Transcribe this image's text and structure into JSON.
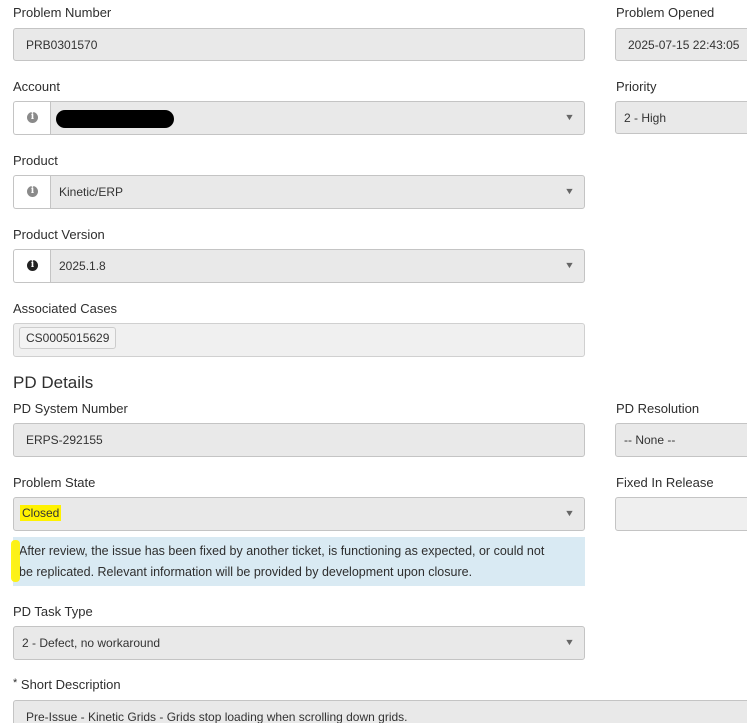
{
  "problem_number": {
    "label": "Problem Number",
    "value": "PRB0301570"
  },
  "problem_opened": {
    "label": "Problem Opened",
    "value": "2025-07-15 22:43:05"
  },
  "account": {
    "label": "Account",
    "value": "",
    "redacted": true,
    "info_icon": "info-icon"
  },
  "priority": {
    "label": "Priority",
    "value": "2 - High"
  },
  "product": {
    "label": "Product",
    "value": "Kinetic/ERP",
    "info_icon": "info-icon"
  },
  "product_version": {
    "label": "Product Version",
    "value": "2025.1.8",
    "info_icon": "info-icon"
  },
  "associated_cases": {
    "label": "Associated Cases",
    "tags": [
      "CS0005015629"
    ]
  },
  "pd_details": {
    "heading": "PD Details"
  },
  "pd_system_number": {
    "label": "PD System Number",
    "value": "ERPS-292155"
  },
  "pd_resolution": {
    "label": "PD Resolution",
    "value": "-- None --"
  },
  "problem_state": {
    "label": "Problem State",
    "value": "Closed",
    "info_line_1": "After review, the issue has been fixed by another ticket, is functioning as expected, or could not",
    "info_line_2": "be replicated. Relevant information will be provided by development upon closure.",
    "highlight_color": "#fff200",
    "info_bg": "#d9eaf3"
  },
  "fixed_in_release": {
    "label": "Fixed In Release",
    "value": ""
  },
  "pd_task_type": {
    "label": "PD Task Type",
    "value": "2 - Defect, no workaround"
  },
  "short_description": {
    "required_marker": "*",
    "label": "Short Description",
    "value": "Pre-Issue - Kinetic Grids  - Grids stop loading when scrolling down grids."
  },
  "icons": {
    "dropdown": "chevron-down-icon",
    "info": "info-icon"
  }
}
